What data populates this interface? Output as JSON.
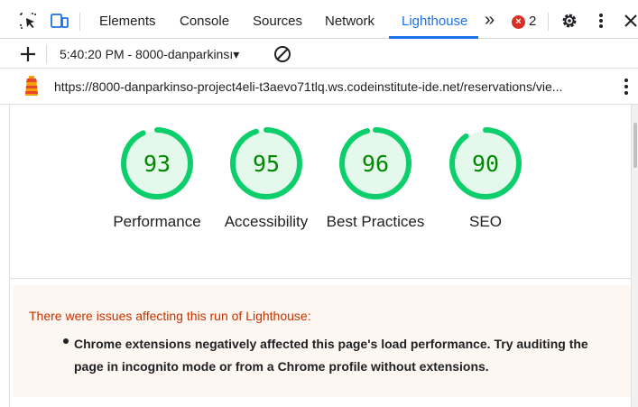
{
  "tabs": [
    {
      "label": "Elements"
    },
    {
      "label": "Console"
    },
    {
      "label": "Sources"
    },
    {
      "label": "Network"
    },
    {
      "label": "Lighthouse"
    }
  ],
  "more_tabs": "»",
  "error_count": "2",
  "error_badge": "×",
  "run": {
    "label": "5:40:20 PM - 8000-danparkinsı▾"
  },
  "url": "https://8000-danparkinso-project4eli-t3aevo71tlq.ws.codeinstitute-ide.net/reservations/vie...",
  "scores": [
    {
      "value": "93",
      "label": "Performance",
      "fraction": 0.93
    },
    {
      "value": "95",
      "label": "Accessibility",
      "fraction": 0.95
    },
    {
      "value": "96",
      "label": "Best Practices",
      "fraction": 0.96
    },
    {
      "value": "90",
      "label": "SEO",
      "fraction": 0.9
    }
  ],
  "warning": {
    "title": "There were issues affecting this run of Lighthouse:",
    "item": "Chrome extensions negatively affected this page's load performance. Try auditing the page in incognito mode or from a Chrome profile without extensions."
  },
  "colors": {
    "pass": "#0cce6b",
    "pass_text": "#008800",
    "pass_bg": "#e5f8ec",
    "accent": "#1a73e8",
    "warn_text": "#c33300"
  }
}
